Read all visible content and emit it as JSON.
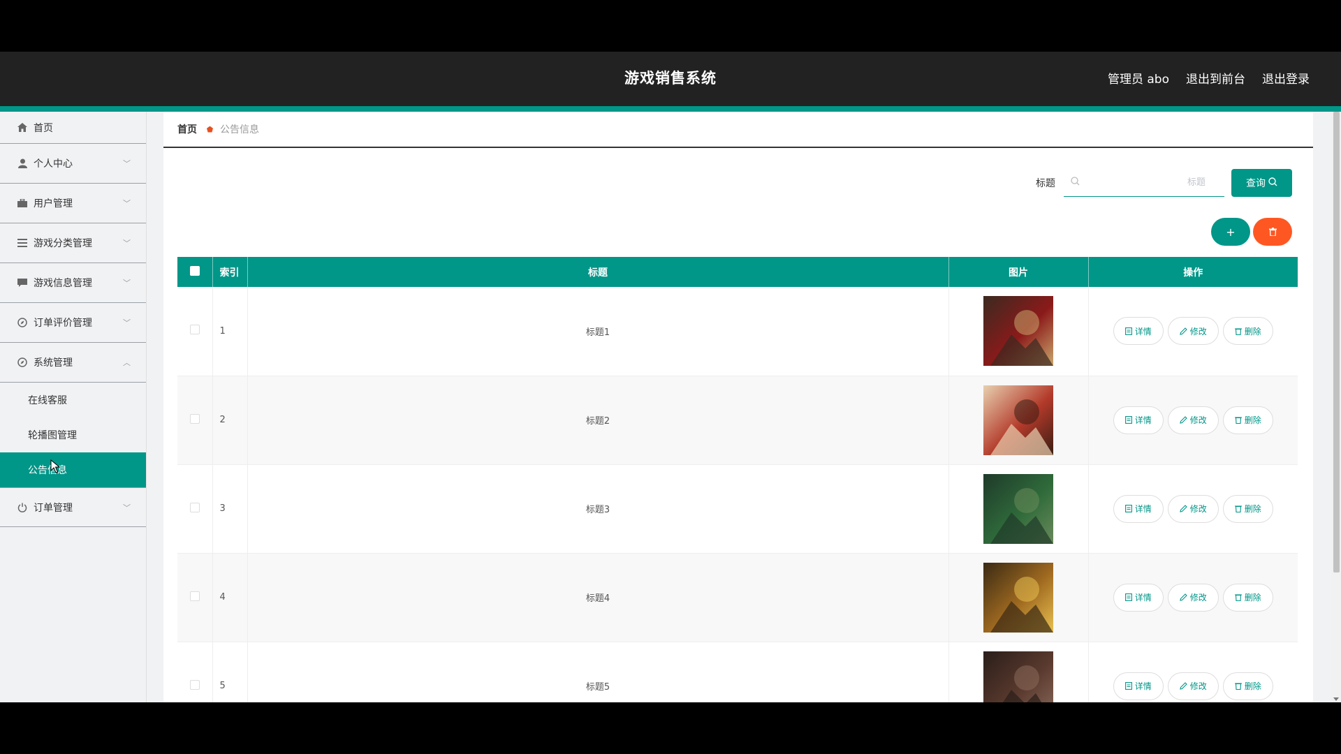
{
  "app": {
    "title": "游戏销售系统",
    "user": "管理员 abo",
    "to_frontend": "退出到前台",
    "logout": "退出登录"
  },
  "sidebar": {
    "items": [
      {
        "label": "首页",
        "icon": "home-icon"
      },
      {
        "label": "个人中心",
        "icon": "user-icon"
      },
      {
        "label": "用户管理",
        "icon": "briefcase-icon"
      },
      {
        "label": "游戏分类管理",
        "icon": "list-icon"
      },
      {
        "label": "游戏信息管理",
        "icon": "message-icon"
      },
      {
        "label": "订单评价管理",
        "icon": "compass-icon"
      },
      {
        "label": "系统管理",
        "icon": "compass-icon"
      },
      {
        "label": "订单管理",
        "icon": "power-icon"
      }
    ],
    "submenu": [
      {
        "label": "在线客服"
      },
      {
        "label": "轮播图管理"
      },
      {
        "label": "公告信息",
        "active": true
      }
    ]
  },
  "breadcrumb": {
    "home": "首页",
    "current": "公告信息"
  },
  "search": {
    "label": "标题",
    "placeholder": "标题",
    "button": "查询"
  },
  "table": {
    "headers": [
      "索引",
      "标题",
      "图片",
      "操作"
    ],
    "rows": [
      {
        "index": "1",
        "title": "标题1",
        "image": "poster-1"
      },
      {
        "index": "2",
        "title": "标题2",
        "image": "poster-2"
      },
      {
        "index": "3",
        "title": "标题3",
        "image": "poster-3"
      },
      {
        "index": "4",
        "title": "标题4",
        "image": "poster-4"
      },
      {
        "index": "5",
        "title": "标题5",
        "image": "poster-5"
      }
    ],
    "ops": {
      "detail": "详情",
      "edit": "修改",
      "delete": "删除"
    }
  },
  "colors": {
    "accent": "#009688",
    "danger": "#ff5722",
    "header_bg": "#222222"
  }
}
